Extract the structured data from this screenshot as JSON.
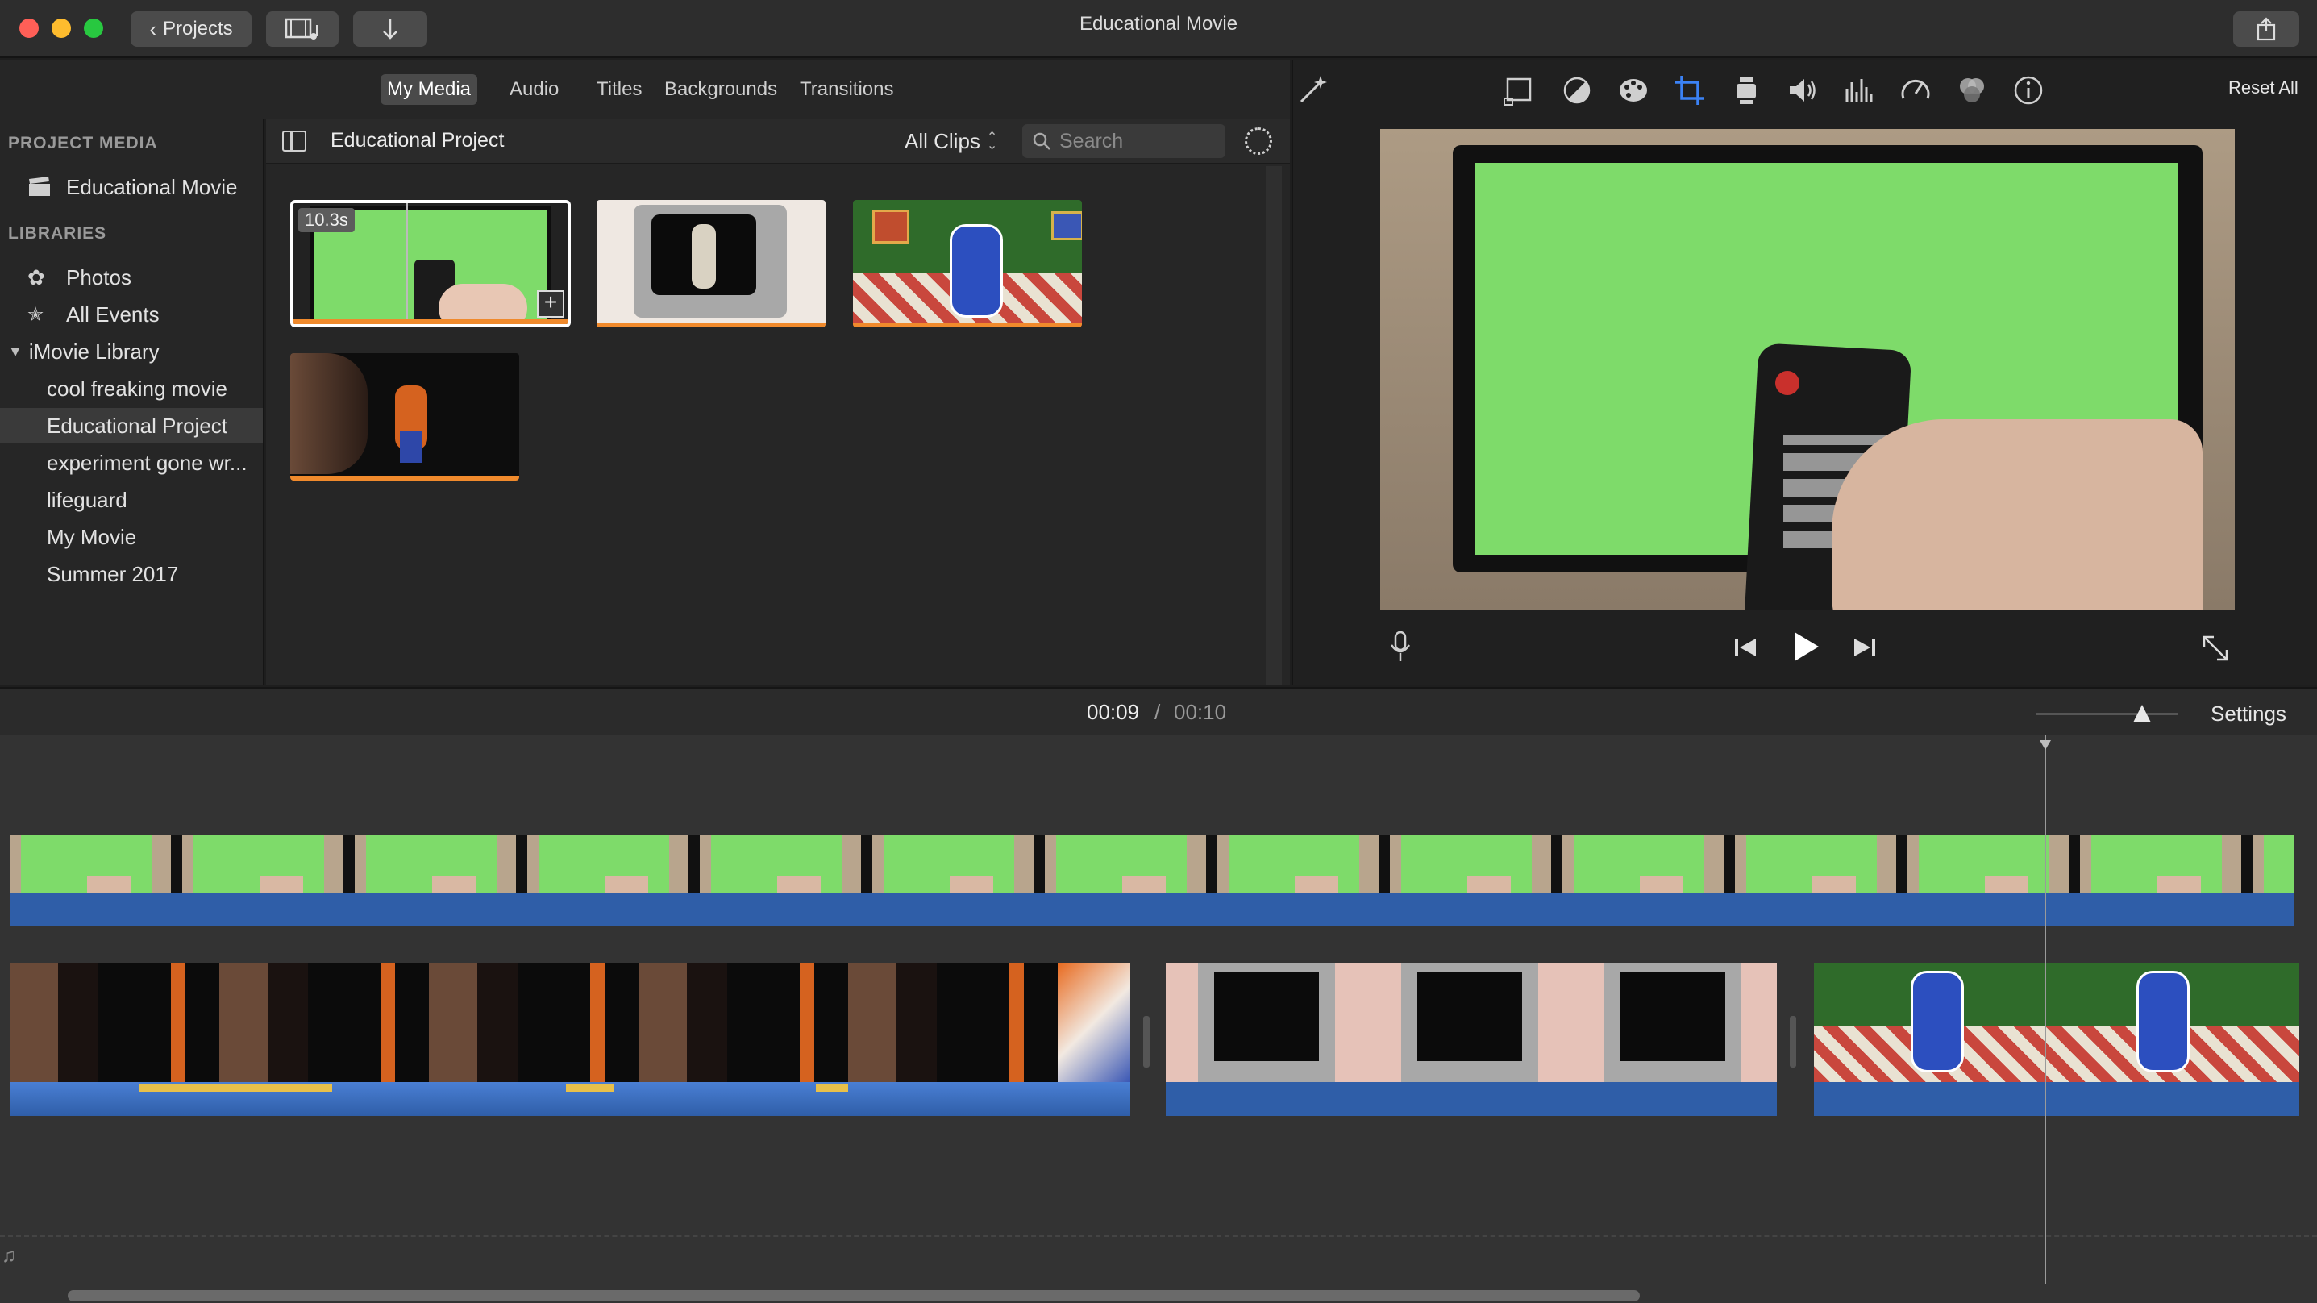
{
  "window": {
    "title": "Educational Movie",
    "projects_label": "Projects"
  },
  "tabs": [
    {
      "label": "My Media",
      "active": true
    },
    {
      "label": "Audio"
    },
    {
      "label": "Titles"
    },
    {
      "label": "Backgrounds"
    },
    {
      "label": "Transitions"
    }
  ],
  "sidebar": {
    "project_media_heading": "PROJECT MEDIA",
    "project_item": "Educational Movie",
    "libraries_heading": "LIBRARIES",
    "photos": "Photos",
    "all_events": "All Events",
    "library_name": "iMovie Library",
    "events": [
      "cool freaking movie",
      "Educational Project",
      "experiment gone wr...",
      "lifeguard",
      "My Movie",
      "Summer 2017"
    ],
    "selected_event": "Educational Project"
  },
  "browser": {
    "title": "Educational Project",
    "filter": "All Clips",
    "search_placeholder": "Search",
    "selected_clip_duration": "10.3s"
  },
  "viewer": {
    "reset_all": "Reset All"
  },
  "timeline": {
    "current_time": "00:09",
    "separator": "/",
    "total_time": "00:10",
    "settings": "Settings"
  },
  "colors": {
    "accent_blue": "#3b82f6",
    "clip_orange": "#f08a2c",
    "green_screen": "#7edb6a",
    "audio_blue": "#2f5ea8"
  }
}
